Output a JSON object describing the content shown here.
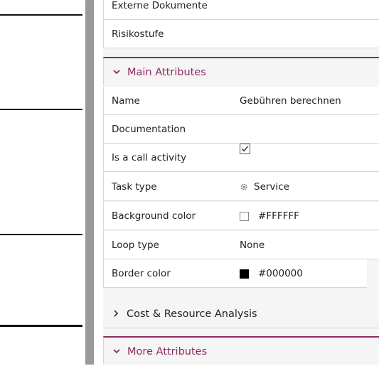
{
  "panel": {
    "rows_top": [
      {
        "label": "Externe Dokumente"
      },
      {
        "label": "Risikostufe"
      }
    ],
    "main_attributes": {
      "title": "Main Attributes",
      "rows": {
        "name": {
          "label": "Name",
          "value": "Gebühren berechnen"
        },
        "documentation": {
          "label": "Documentation",
          "value": ""
        },
        "call_activity": {
          "label": "Is a call activity",
          "checked": true
        },
        "task_type": {
          "label": "Task type",
          "value": "Service",
          "icon": "gear-icon"
        },
        "background_color": {
          "label": "Background color",
          "value": "#FFFFFF",
          "swatch": "#FFFFFF"
        },
        "loop_type": {
          "label": "Loop type",
          "value": "None"
        },
        "border_color": {
          "label": "Border color",
          "value": "#000000",
          "swatch": "#000000"
        }
      }
    },
    "cost_resource": {
      "title": "Cost & Resource Analysis"
    },
    "more_attributes": {
      "title": "More Attributes"
    }
  },
  "colors": {
    "accent": "#8e2a61",
    "divider": "#9a9a9a",
    "panel_bg": "#f5f5f5"
  }
}
